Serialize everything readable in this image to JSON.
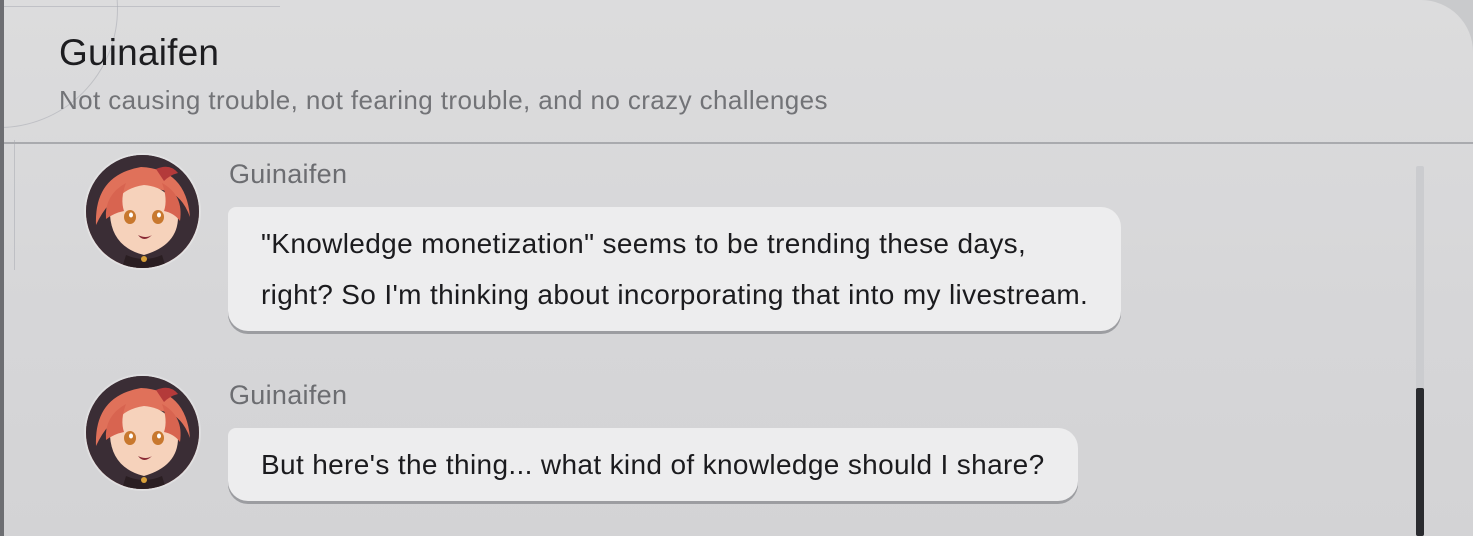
{
  "header": {
    "title": "Guinaifen",
    "subtitle": "Not causing trouble, not fearing trouble, and no crazy challenges"
  },
  "messages": [
    {
      "sender": "Guinaifen",
      "text": "\"Knowledge monetization\" seems to be trending these days,\nright? So I'm thinking about incorporating that into my livestream."
    },
    {
      "sender": "Guinaifen",
      "text": "But here's the thing... what kind of knowledge should I share?"
    }
  ],
  "colors": {
    "panel_bg": "#d8d8da",
    "bubble_bg": "#ededee",
    "title_text": "#1d1d20",
    "muted_text": "#727377",
    "scroll_thumb": "#2a2b2f"
  }
}
